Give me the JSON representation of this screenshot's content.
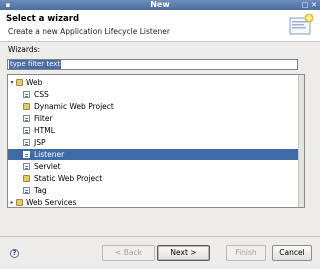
{
  "window": {
    "title": "New"
  },
  "header": {
    "title": "Select a wizard",
    "description": "Create a new Application Lifecycle Listener"
  },
  "wizards_label": "Wizards:",
  "filter": {
    "placeholder": "type filter text"
  },
  "tree": {
    "items": [
      {
        "label": "Web",
        "level": 0,
        "expanded": true,
        "icon": "folder-icon"
      },
      {
        "label": "CSS",
        "level": 1,
        "icon": "file-icon"
      },
      {
        "label": "Dynamic Web Project",
        "level": 1,
        "icon": "project-icon"
      },
      {
        "label": "Filter",
        "level": 1,
        "icon": "file-icon"
      },
      {
        "label": "HTML",
        "level": 1,
        "icon": "file-icon"
      },
      {
        "label": "JSP",
        "level": 1,
        "icon": "file-icon"
      },
      {
        "label": "Listener",
        "level": 1,
        "icon": "file-icon",
        "selected": true
      },
      {
        "label": "Servlet",
        "level": 1,
        "icon": "file-icon"
      },
      {
        "label": "Static Web Project",
        "level": 1,
        "icon": "project-icon"
      },
      {
        "label": "Tag",
        "level": 1,
        "icon": "file-icon"
      },
      {
        "label": "Web Services",
        "level": 0,
        "expanded": false,
        "icon": "folder-icon"
      }
    ]
  },
  "buttons": {
    "back": "< Back",
    "next": "Next >",
    "finish": "Finish",
    "cancel": "Cancel"
  },
  "colors": {
    "selection": "#3c6ba5",
    "titlebar": "#4a6c9f"
  }
}
